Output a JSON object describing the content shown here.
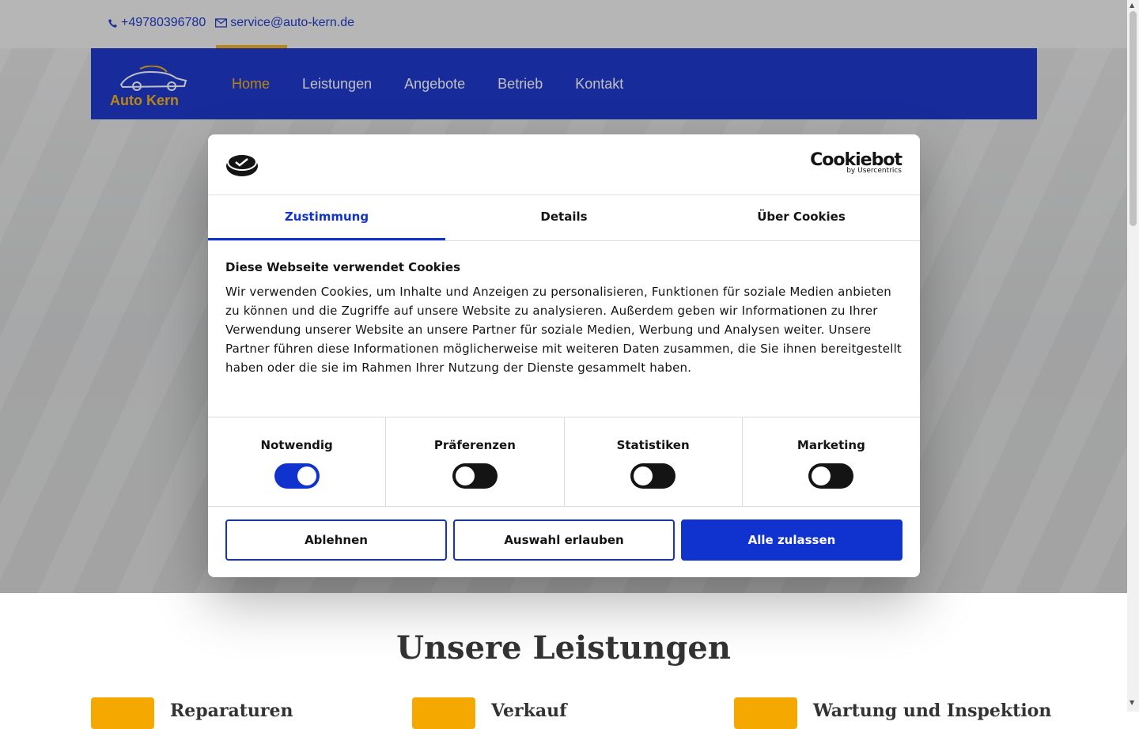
{
  "topbar": {
    "phone": "+49780396780",
    "email": "service@auto-kern.de"
  },
  "brand": {
    "logo_text": "Auto Kern"
  },
  "nav": {
    "items": [
      {
        "label": "Home",
        "active": true
      },
      {
        "label": "Leistungen",
        "active": false
      },
      {
        "label": "Angebote",
        "active": false
      },
      {
        "label": "Betrieb",
        "active": false
      },
      {
        "label": "Kontakt",
        "active": false
      }
    ]
  },
  "section": {
    "title": "Unsere Leistungen",
    "services": [
      "Reparaturen",
      "Verkauf",
      "Wartung und Inspektion"
    ]
  },
  "cookie_dialog": {
    "brand_name": "Cookiebot",
    "brand_by": "by Usercentrics",
    "tabs": [
      "Zustimmung",
      "Details",
      "Über Cookies"
    ],
    "heading": "Diese Webseite verwendet Cookies",
    "text": "Wir verwenden Cookies, um Inhalte und Anzeigen zu personalisieren, Funktionen für soziale Medien anbieten zu können und die Zugriffe auf unsere Website zu analysieren. Außerdem geben wir Informationen zu Ihrer Verwendung unserer Website an unsere Partner für soziale Medien, Werbung und Analysen weiter. Unsere Partner führen diese Informationen möglicherweise mit weiteren Daten zusammen, die Sie ihnen bereitgestellt haben oder die sie im Rahmen Ihrer Nutzung der Dienste gesammelt haben.",
    "categories": [
      {
        "label": "Notwendig",
        "enabled": true
      },
      {
        "label": "Präferenzen",
        "enabled": false
      },
      {
        "label": "Statistiken",
        "enabled": false
      },
      {
        "label": "Marketing",
        "enabled": false
      }
    ],
    "buttons": {
      "decline": "Ablehnen",
      "allow_selection": "Auswahl erlauben",
      "allow_all": "Alle zulassen"
    }
  },
  "colors": {
    "nav_blue": "#0626c8",
    "accent": "#f5a800",
    "cookiebot_blue": "#1032cf"
  }
}
